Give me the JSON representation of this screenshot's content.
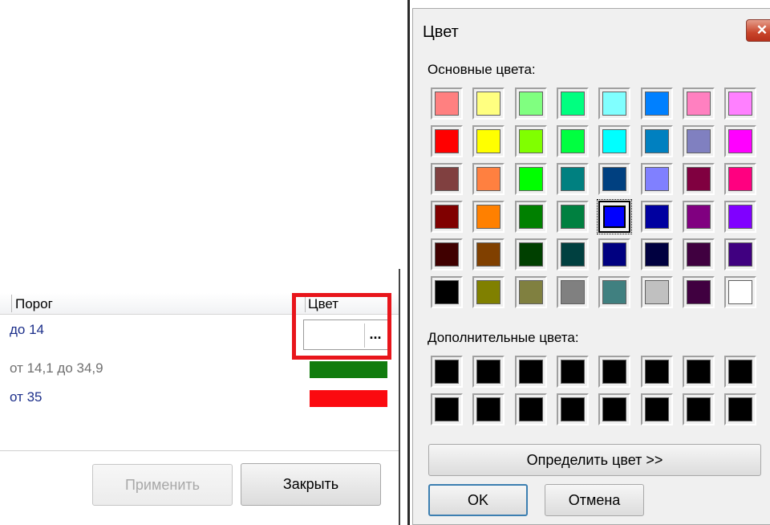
{
  "panel": {
    "columns": [
      "Порог",
      "Цвет"
    ],
    "rows": [
      {
        "label": "до 14",
        "color": ""
      },
      {
        "label": "от 14,1 до 34,9",
        "color": "#117c0e"
      },
      {
        "label": "от 35",
        "color": "#fb0a10"
      }
    ],
    "ellipsis": "...",
    "apply_label": "Применить",
    "close_label": "Закрыть"
  },
  "dialog": {
    "title": "Цвет",
    "close_glyph": "✕",
    "basic_colors_label": "Основные цвета:",
    "basic_colors": [
      [
        "#ff8080",
        "#ffff80",
        "#80ff80",
        "#00ff80",
        "#80ffff",
        "#0080ff",
        "#ff80c0",
        "#ff80ff"
      ],
      [
        "#ff0000",
        "#ffff00",
        "#80ff00",
        "#00ff40",
        "#00ffff",
        "#0080c0",
        "#8080c0",
        "#ff00ff"
      ],
      [
        "#804040",
        "#ff8040",
        "#00ff00",
        "#008080",
        "#004080",
        "#8080ff",
        "#800040",
        "#ff0080"
      ],
      [
        "#800000",
        "#ff8000",
        "#008000",
        "#008040",
        "#0000ff",
        "#0000a0",
        "#800080",
        "#8000ff"
      ],
      [
        "#400000",
        "#804000",
        "#004000",
        "#004040",
        "#000080",
        "#000040",
        "#400040",
        "#400080"
      ],
      [
        "#000000",
        "#808000",
        "#808040",
        "#808080",
        "#408080",
        "#c0c0c0",
        "#400040",
        "#ffffff"
      ]
    ],
    "selected_color": "#0000ff",
    "custom_colors_label": "Дополнительные цвета:",
    "custom_colors": [
      [
        "#000000",
        "#000000",
        "#000000",
        "#000000",
        "#000000",
        "#000000",
        "#000000",
        "#000000"
      ],
      [
        "#000000",
        "#000000",
        "#000000",
        "#000000",
        "#000000",
        "#000000",
        "#000000",
        "#000000"
      ]
    ],
    "define_label": "Определить цвет >>",
    "ok_label": "OK",
    "cancel_label": "Отмена"
  }
}
